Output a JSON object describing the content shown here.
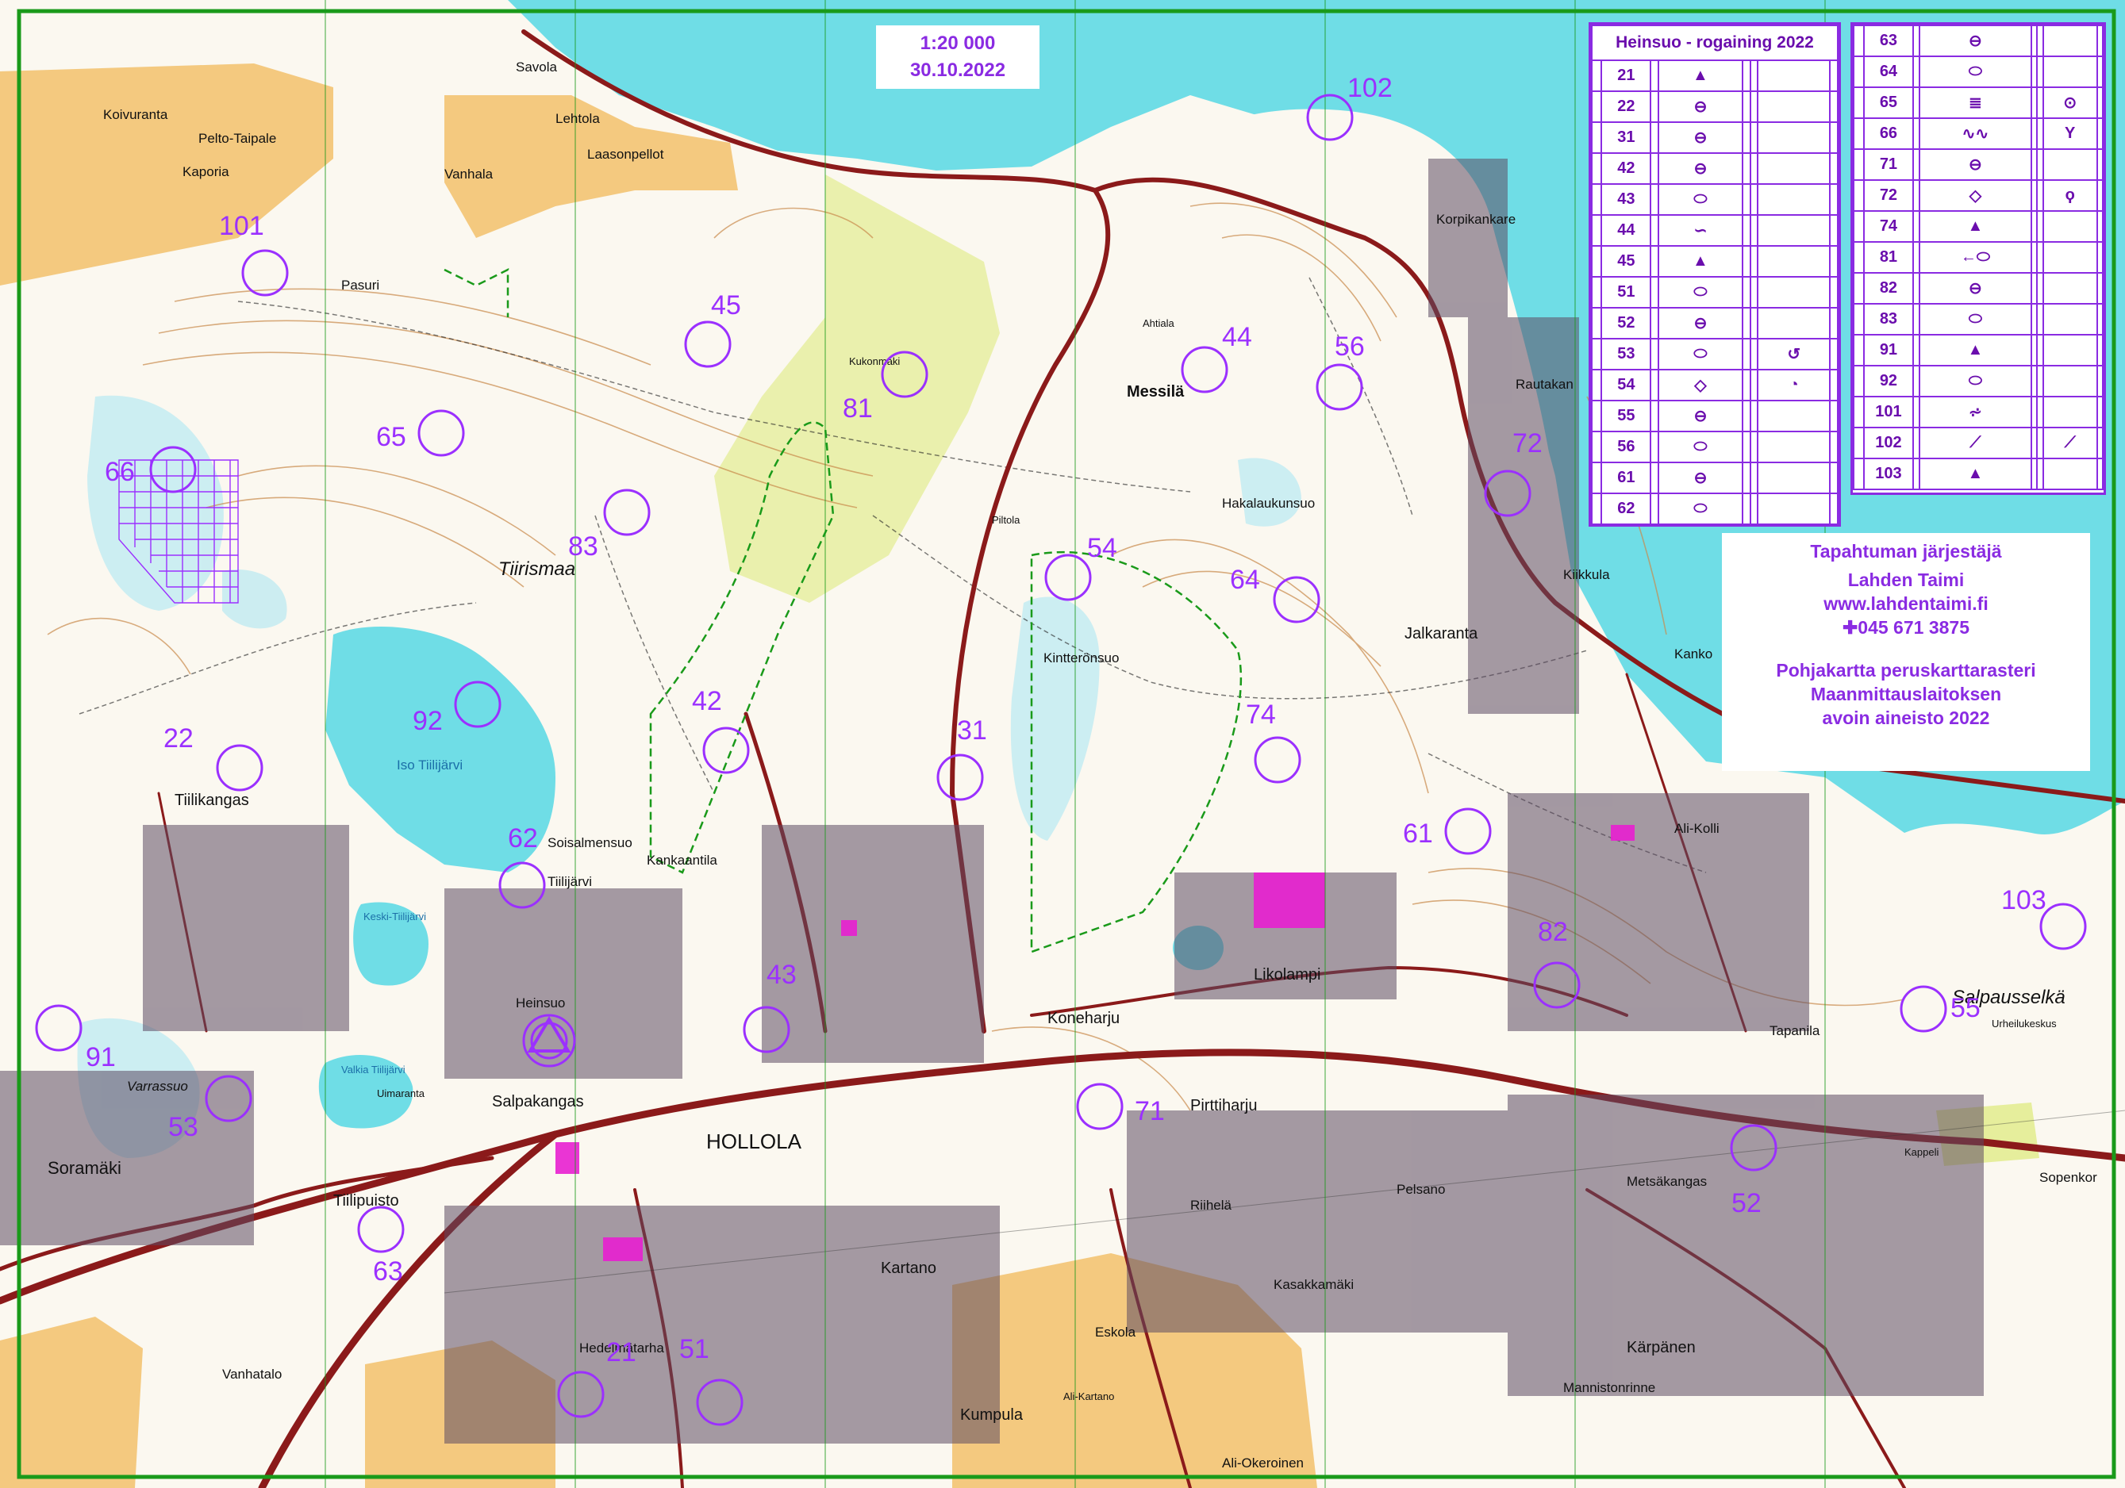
{
  "map": {
    "scale": "1:20 000",
    "date": "30.10.2022",
    "frame_color": "#1a9a1a",
    "control_color": "#9b30ff",
    "water_color": "#6fdde6"
  },
  "controls": [
    {
      "id": "21",
      "label": "21"
    },
    {
      "id": "22",
      "label": "22"
    },
    {
      "id": "31",
      "label": "31"
    },
    {
      "id": "42",
      "label": "42"
    },
    {
      "id": "43",
      "label": "43"
    },
    {
      "id": "44",
      "label": "44"
    },
    {
      "id": "45",
      "label": "45"
    },
    {
      "id": "51",
      "label": "51"
    },
    {
      "id": "52",
      "label": "52"
    },
    {
      "id": "53",
      "label": "53"
    },
    {
      "id": "54",
      "label": "54"
    },
    {
      "id": "55",
      "label": "55"
    },
    {
      "id": "56",
      "label": "56"
    },
    {
      "id": "61",
      "label": "61"
    },
    {
      "id": "62",
      "label": "62"
    },
    {
      "id": "63",
      "label": "63"
    },
    {
      "id": "64",
      "label": "64"
    },
    {
      "id": "65",
      "label": "65"
    },
    {
      "id": "66",
      "label": "66"
    },
    {
      "id": "71",
      "label": "71"
    },
    {
      "id": "72",
      "label": "72"
    },
    {
      "id": "74",
      "label": "74"
    },
    {
      "id": "81",
      "label": "81"
    },
    {
      "id": "82",
      "label": "82"
    },
    {
      "id": "83",
      "label": "83"
    },
    {
      "id": "91",
      "label": "91"
    },
    {
      "id": "92",
      "label": "92"
    },
    {
      "id": "101",
      "label": "101"
    },
    {
      "id": "102",
      "label": "102"
    },
    {
      "id": "103",
      "label": "103"
    }
  ],
  "places": [
    "Savola",
    "Koivuranta",
    "Pelto-Taipale",
    "Kaporia",
    "Vanhala",
    "Lehtola",
    "Laasonpellot",
    "Pasuri",
    "Tiirismaa",
    "Messilä",
    "Korpikankare",
    "Rautakan",
    "Hakalaukunsuo",
    "Kiikkula",
    "Jalkaranta",
    "Kanko",
    "Ali-Kolli",
    "Kintterönsuo",
    "Iso Tiilijärvi",
    "Tiilikangas",
    "Tiilijärvi",
    "Soisalmensuo",
    "Kankaantila",
    "Keski-Tiilijärvi",
    "Heinsuo",
    "Varrassuo",
    "Soramäki",
    "Salpakangas",
    "Valkia Tiilijärvi",
    "Uimaranta",
    "HOLLOLA",
    "Tiilipuisto",
    "Koneharju",
    "Likolampi",
    "Pirttiharju",
    "Riihelä",
    "Kasakkamäki",
    "Kartano",
    "Hedelmätarha",
    "Vanhatalo",
    "Kumpula",
    "Eskola",
    "Ali-Okeroinen",
    "Metsäkangas",
    "Pelsano",
    "Tapanila",
    "Salpausselkä",
    "Kärpänen",
    "Sopenkor",
    "Mannistonrinne",
    "Urheilukeskus",
    "Kappeli",
    "Ali-Kartano",
    "Piltola",
    "Ahtiala",
    "Kukonmäki"
  ],
  "descriptions": {
    "title": "Heinsuo - rogaining 2022",
    "left": [
      {
        "code": "21",
        "symbol": "▲",
        "extra": ""
      },
      {
        "code": "22",
        "symbol": "⊖",
        "extra": ""
      },
      {
        "code": "31",
        "symbol": "⊖",
        "extra": ""
      },
      {
        "code": "42",
        "symbol": "⊖",
        "extra": ""
      },
      {
        "code": "43",
        "symbol": "⬭",
        "extra": ""
      },
      {
        "code": "44",
        "symbol": "∽",
        "extra": ""
      },
      {
        "code": "45",
        "symbol": "▲",
        "extra": ""
      },
      {
        "code": "51",
        "symbol": "⬭",
        "extra": ""
      },
      {
        "code": "52",
        "symbol": "⊖",
        "extra": ""
      },
      {
        "code": "53",
        "symbol": "⬭",
        "extra": "↺"
      },
      {
        "code": "54",
        "symbol": "◇",
        "extra": "◔"
      },
      {
        "code": "55",
        "symbol": "⊖",
        "extra": ""
      },
      {
        "code": "56",
        "symbol": "⬭",
        "extra": ""
      },
      {
        "code": "61",
        "symbol": "⊖",
        "extra": ""
      },
      {
        "code": "62",
        "symbol": "⬭",
        "extra": ""
      }
    ],
    "right": [
      {
        "code": "63",
        "symbol": "⊖",
        "extra": ""
      },
      {
        "code": "64",
        "symbol": "⬭",
        "extra": ""
      },
      {
        "code": "65",
        "symbol": "≣",
        "extra": "⊙"
      },
      {
        "code": "66",
        "symbol": "∿∿",
        "extra": "Y"
      },
      {
        "code": "71",
        "symbol": "⊖",
        "extra": ""
      },
      {
        "code": "72",
        "symbol": "◇",
        "extra": "ϙ"
      },
      {
        "code": "74",
        "symbol": "▲",
        "extra": ""
      },
      {
        "code": "81",
        "symbol": "←⬭",
        "extra": ""
      },
      {
        "code": "82",
        "symbol": "⊖",
        "extra": ""
      },
      {
        "code": "83",
        "symbol": "⬭",
        "extra": ""
      },
      {
        "code": "91",
        "symbol": "▲",
        "extra": ""
      },
      {
        "code": "92",
        "symbol": "⬭",
        "extra": ""
      },
      {
        "code": "101",
        "symbol": "⩫",
        "extra": ""
      },
      {
        "code": "102",
        "symbol": "⟋",
        "extra": "⟋"
      },
      {
        "code": "103",
        "symbol": "▲",
        "extra": ""
      }
    ]
  },
  "organizer": {
    "line1": "Tapahtuman järjestäjä",
    "line2": "Lahden Taimi",
    "line3": "www.lahdentaimi.fi",
    "line4": "✚045 671 3875",
    "line5": "Pohjakartta peruskarttarasteri",
    "line6": "Maanmittauslaitoksen",
    "line7": "avoin aineisto 2022"
  }
}
